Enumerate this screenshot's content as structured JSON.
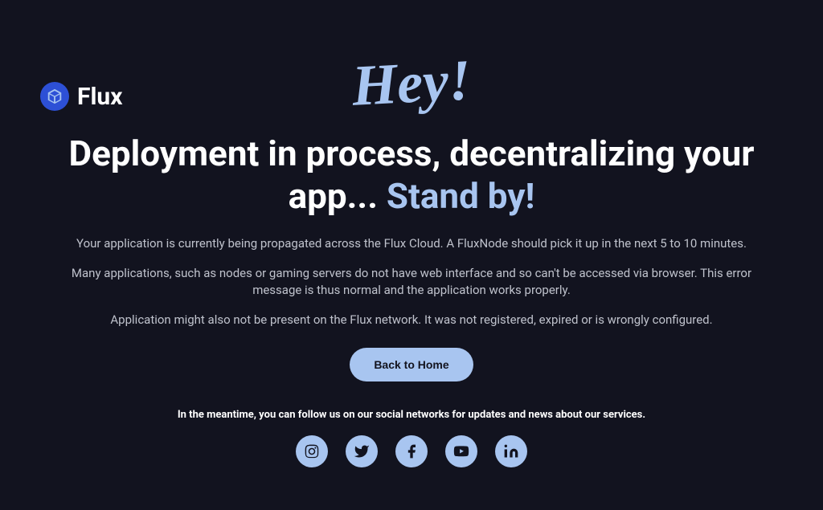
{
  "logo": {
    "text": "Flux"
  },
  "hero": {
    "hey": "Hey!",
    "heading_part1": "Deployment in process, decentralizing your app... ",
    "heading_standby": "Stand by!"
  },
  "descriptions": {
    "p1": "Your application is currently being propagated across the Flux Cloud. A FluxNode should pick it up in the next 5 to 10 minutes.",
    "p2": "Many applications, such as nodes or gaming servers do not have web interface and so can't be accessed via browser. This error message is thus normal and the application works properly.",
    "p3": "Application might also not be present on the Flux network. It was not registered, expired or is wrongly configured."
  },
  "button": {
    "back_label": "Back to Home"
  },
  "social": {
    "text": "In the meantime, you can follow us on our social networks for updates and news about our services."
  }
}
